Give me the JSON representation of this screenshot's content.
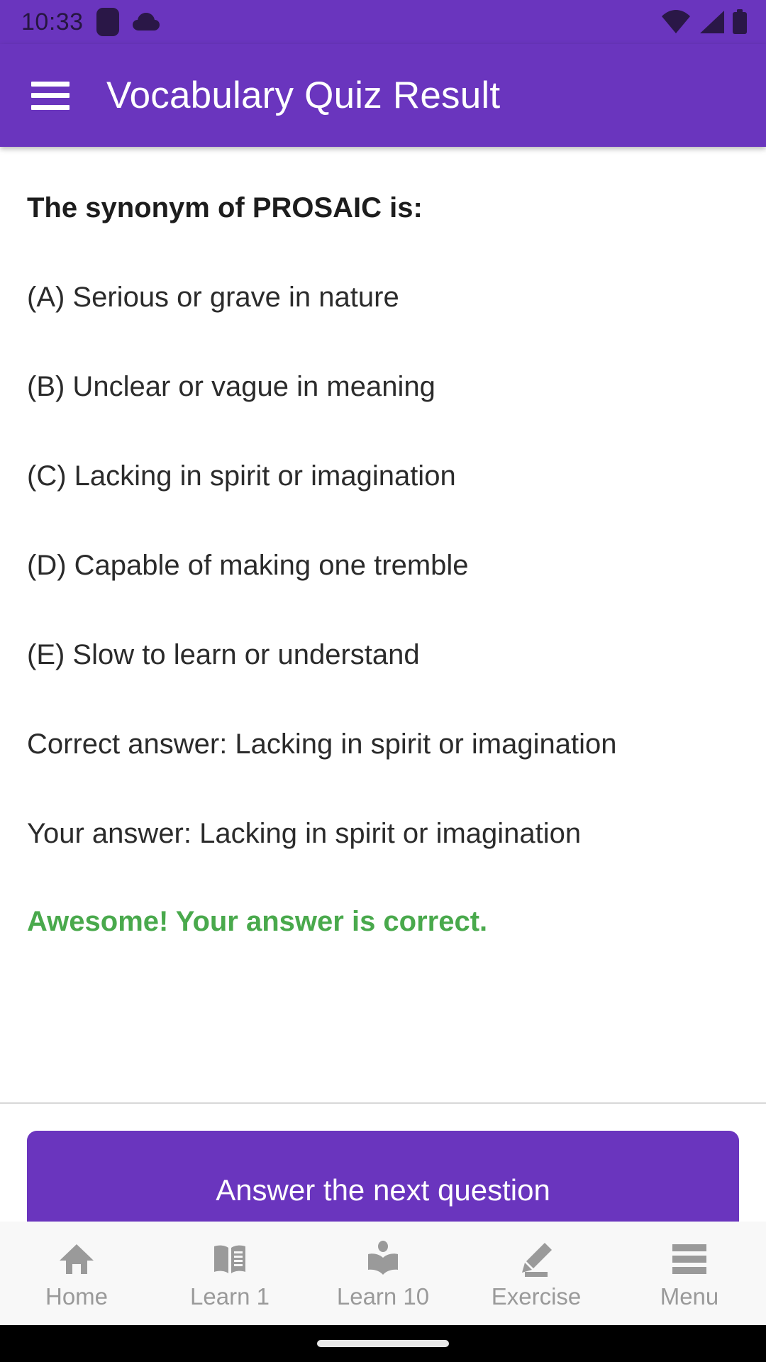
{
  "status_bar": {
    "time": "10:33",
    "icons": [
      "rounded-square-icon",
      "cloud-icon",
      "wifi-icon",
      "signal-icon",
      "battery-icon"
    ]
  },
  "app_bar": {
    "menu_icon": "hamburger-menu-icon",
    "title": "Vocabulary Quiz Result"
  },
  "quiz": {
    "question": "The synonym of PROSAIC is:",
    "options": [
      "(A) Serious or grave in nature",
      "(B) Unclear or vague in meaning",
      "(C) Lacking in spirit or imagination",
      "(D) Capable of making one tremble",
      "(E) Slow to learn or understand"
    ],
    "correct_answer_line": "Correct answer: Lacking in spirit or imagination",
    "your_answer_line": "Your answer: Lacking in spirit or imagination",
    "verdict": "Awesome! Your answer is correct.",
    "next_button": "Answer the next question"
  },
  "bottom_nav": {
    "items": [
      {
        "label": "Home",
        "icon": "home-icon"
      },
      {
        "label": "Learn 1",
        "icon": "open-book-icon"
      },
      {
        "label": "Learn 10",
        "icon": "person-reading-icon"
      },
      {
        "label": "Exercise",
        "icon": "pencil-icon"
      },
      {
        "label": "Menu",
        "icon": "hamburger-menu-icon"
      }
    ]
  },
  "colors": {
    "primary_purple": "#6a35be",
    "status_icon_dark": "#2a1747",
    "correct_green": "#49a94c",
    "nav_grey": "#9a9a9a",
    "text_dark": "#2b2b2b"
  }
}
